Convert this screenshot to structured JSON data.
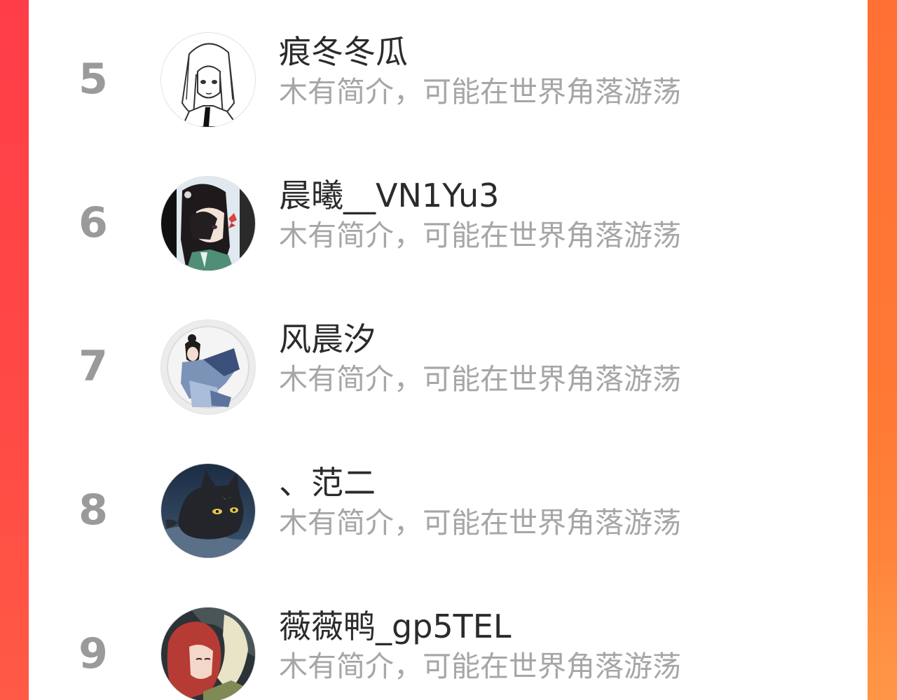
{
  "colors": {
    "frame_left": "#ff4a45",
    "frame_right": "#ff7a35",
    "rank_number": "#9a9a9a",
    "name_text": "#2b2b2b",
    "intro_text": "#a6a6a6"
  },
  "ranking": [
    {
      "rank": "5",
      "name": "痕冬冬瓜",
      "intro": "木有简介，可能在世界角落游荡",
      "avatar_icon": "manga-girl-avatar-icon"
    },
    {
      "rank": "6",
      "name": "晨曦__VN1Yu3",
      "intro": "木有简介，可能在世界角落游荡",
      "avatar_icon": "anime-girl-butterfly-avatar-icon"
    },
    {
      "rank": "7",
      "name": "风晨汐",
      "intro": "木有简介，可能在世界角落游荡",
      "avatar_icon": "hanfu-girl-avatar-icon"
    },
    {
      "rank": "8",
      "name": "、范二",
      "intro": "木有简介，可能在世界角落游荡",
      "avatar_icon": "black-cat-moon-avatar-icon"
    },
    {
      "rank": "9",
      "name": "薇薇鸭_gp5TEL",
      "intro": "木有简介，可能在世界角落游荡",
      "avatar_icon": "red-hair-couple-avatar-icon"
    }
  ]
}
